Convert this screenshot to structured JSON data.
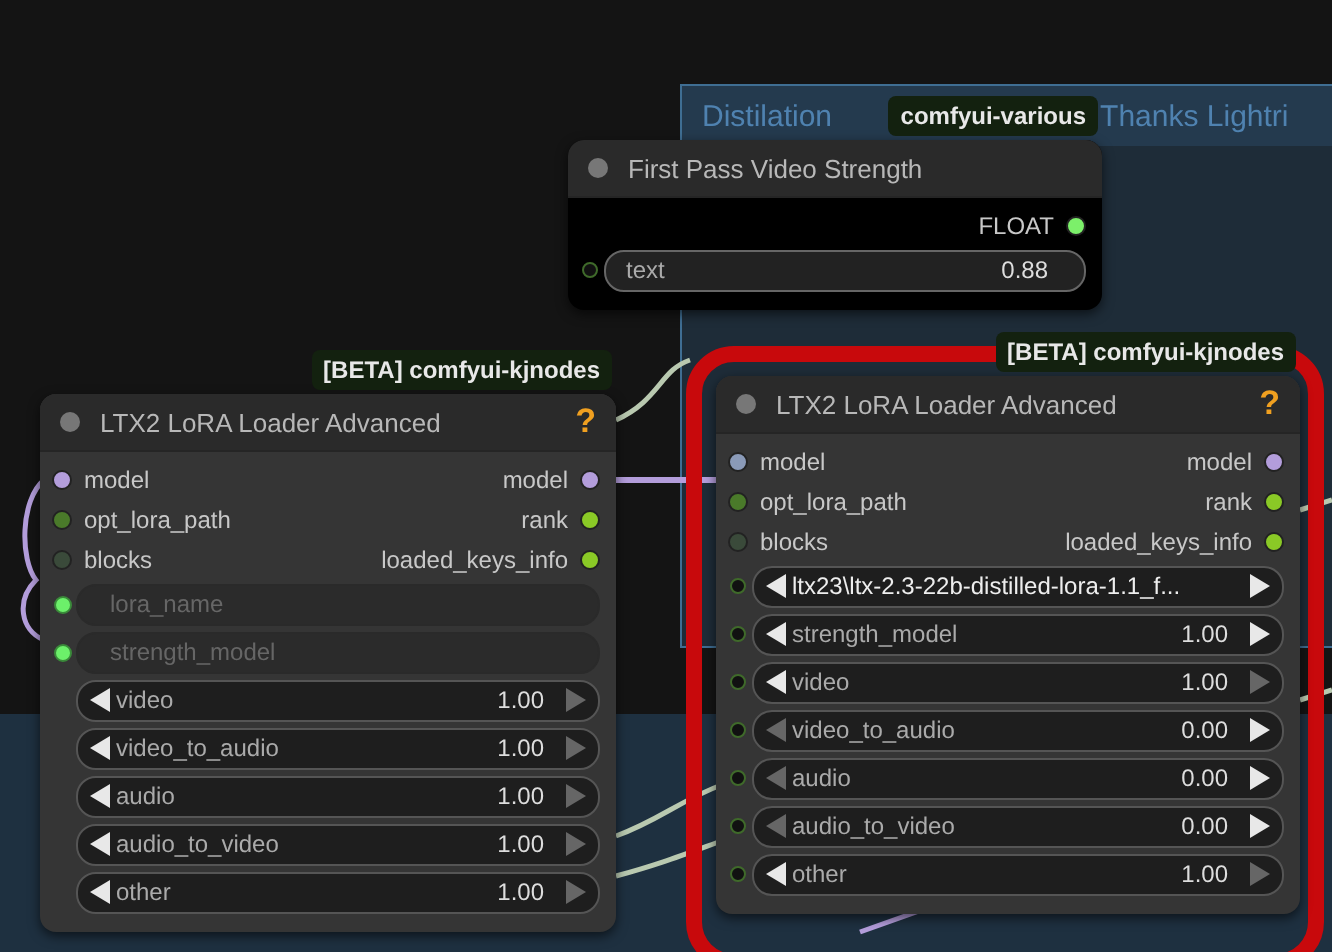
{
  "group": {
    "title_parts": [
      "Distilation",
      "Thanks Lightri"
    ]
  },
  "nodes": [
    {
      "title": "First Pass Video Strength",
      "badge": "comfyui-various",
      "color": "#000000",
      "slots": [
        {
          "right": {
            "label": "FLOAT",
            "color": "#7cf06a"
          }
        }
      ],
      "widgets": [
        {
          "kind": "text",
          "label": "text",
          "value": "0.88",
          "socket": true
        }
      ]
    },
    {
      "title": "LTX2 LoRA Loader Advanced",
      "badge": "[BETA] comfyui-kjnodes",
      "help": "?",
      "color": "#353535",
      "slots": [
        {
          "left": {
            "label": "model",
            "color": "#b39ddb"
          },
          "right": {
            "label": "model",
            "color": "#b39ddb"
          }
        },
        {
          "left": {
            "label": "opt_lora_path",
            "color": "#4a7a2a"
          },
          "right": {
            "label": "rank",
            "color": "#8ac926"
          }
        },
        {
          "left": {
            "label": "blocks",
            "color": "#3a4a3a"
          },
          "right": {
            "label": "loaded_keys_info",
            "color": "#8ac926"
          }
        }
      ],
      "widgets": [
        {
          "kind": "input",
          "label": "lora_name",
          "socket": true
        },
        {
          "kind": "input",
          "label": "strength_model",
          "socket": true
        },
        {
          "kind": "number",
          "label": "video",
          "value": "1.00",
          "left_enabled": true,
          "right_enabled": false,
          "socket": false
        },
        {
          "kind": "number",
          "label": "video_to_audio",
          "value": "1.00",
          "left_enabled": true,
          "right_enabled": false,
          "socket": false
        },
        {
          "kind": "number",
          "label": "audio",
          "value": "1.00",
          "left_enabled": true,
          "right_enabled": false,
          "socket": false
        },
        {
          "kind": "number",
          "label": "audio_to_video",
          "value": "1.00",
          "left_enabled": true,
          "right_enabled": false,
          "socket": false
        },
        {
          "kind": "number",
          "label": "other",
          "value": "1.00",
          "left_enabled": true,
          "right_enabled": false,
          "socket": false
        }
      ]
    },
    {
      "title": "LTX2 LoRA Loader Advanced",
      "badge": "[BETA] comfyui-kjnodes",
      "help": "?",
      "color": "#353535",
      "highlighted": true,
      "slots": [
        {
          "left": {
            "label": "model",
            "color": "#8a9ab8"
          },
          "right": {
            "label": "model",
            "color": "#b39ddb"
          }
        },
        {
          "left": {
            "label": "opt_lora_path",
            "color": "#4a7a2a"
          },
          "right": {
            "label": "rank",
            "color": "#8ac926"
          }
        },
        {
          "left": {
            "label": "blocks",
            "color": "#3a4a3a"
          },
          "right": {
            "label": "loaded_keys_info",
            "color": "#8ac926"
          }
        }
      ],
      "widgets": [
        {
          "kind": "combo",
          "value": "ltx23\\ltx-2.3-22b-distilled-lora-1.1_f...",
          "left_enabled": true,
          "right_enabled": true,
          "socket": true
        },
        {
          "kind": "number",
          "label": "strength_model",
          "value": "1.00",
          "left_enabled": true,
          "right_enabled": true,
          "socket": true
        },
        {
          "kind": "number",
          "label": "video",
          "value": "1.00",
          "left_enabled": true,
          "right_enabled": false,
          "socket": true
        },
        {
          "kind": "number",
          "label": "video_to_audio",
          "value": "0.00",
          "left_enabled": false,
          "right_enabled": true,
          "socket": true
        },
        {
          "kind": "number",
          "label": "audio",
          "value": "0.00",
          "left_enabled": false,
          "right_enabled": true,
          "socket": true
        },
        {
          "kind": "number",
          "label": "audio_to_video",
          "value": "0.00",
          "left_enabled": false,
          "right_enabled": true,
          "socket": true
        },
        {
          "kind": "number",
          "label": "other",
          "value": "1.00",
          "left_enabled": true,
          "right_enabled": false,
          "socket": true
        }
      ]
    }
  ]
}
